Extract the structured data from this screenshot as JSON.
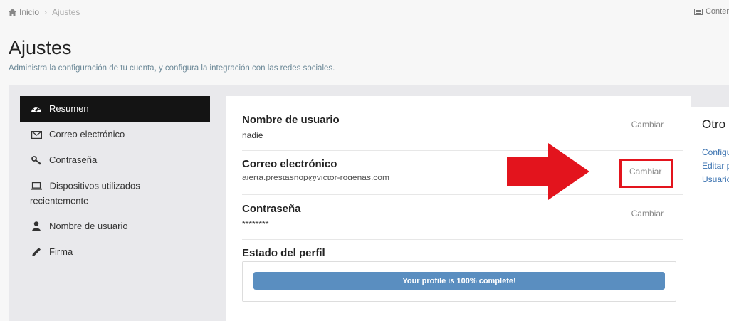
{
  "breadcrumb": {
    "home": "Inicio",
    "separator": "›",
    "current": "Ajustes"
  },
  "top_right": {
    "label": "Conter",
    "icon": "newspaper-icon"
  },
  "page": {
    "title": "Ajustes",
    "subtitle": "Administra la configuración de tu cuenta, y configura la integración con las redes sociales."
  },
  "sidebar": {
    "items": [
      {
        "label": "Resumen",
        "icon": "dashboard-icon",
        "active": true
      },
      {
        "label": "Correo electrónico",
        "icon": "envelope-icon",
        "active": false
      },
      {
        "label": "Contraseña",
        "icon": "key-icon",
        "active": false
      },
      {
        "label": "Dispositivos utilizados recientemente",
        "icon": "laptop-icon",
        "active": false
      },
      {
        "label": "Nombre de usuario",
        "icon": "user-icon",
        "active": false
      },
      {
        "label": "Firma",
        "icon": "pencil-icon",
        "active": false
      }
    ]
  },
  "main": {
    "rows": [
      {
        "label": "Nombre de usuario",
        "value": "nadie",
        "action": "Cambiar"
      },
      {
        "label": "Correo electrónico",
        "value": "alerta.prestashop@victor-rodenas.com",
        "action": "Cambiar"
      },
      {
        "label": "Contraseña",
        "value": "********",
        "action": "Cambiar"
      }
    ],
    "profile": {
      "label": "Estado del perfil",
      "progress_text": "Your profile is 100% complete!",
      "progress_percent": 100
    }
  },
  "side_card": {
    "title": "Otro",
    "links": [
      "Configu",
      "Editar p",
      "Usuario"
    ]
  },
  "colors": {
    "accent_red": "#e3141d",
    "progress_blue": "#5a8ec0",
    "link_blue": "#3a72b0",
    "active_bg": "#141414"
  }
}
